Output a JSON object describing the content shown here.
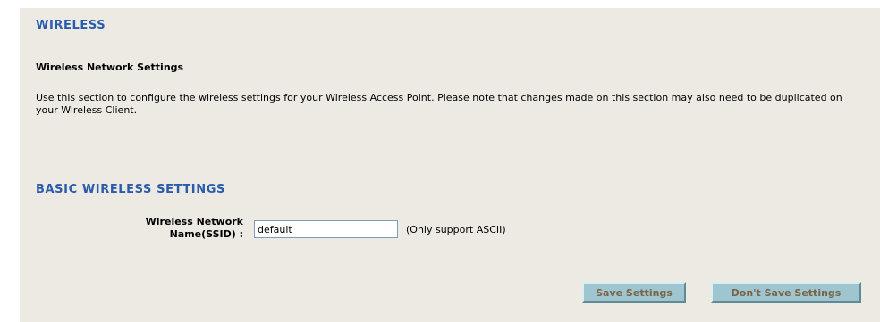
{
  "wireless": {
    "section_title": "WIRELESS",
    "subheading": "Wireless Network Settings",
    "description": "Use this section to configure the wireless settings for your Wireless Access Point. Please note that changes made on this section may also need to be duplicated on your Wireless Client."
  },
  "basic": {
    "section_title": "BASIC WIRELESS SETTINGS",
    "ssid_label_line1": "Wireless Network",
    "ssid_label_line2": "Name(SSID) :",
    "ssid_value": "default",
    "ssid_hint": "(Only support ASCII)"
  },
  "buttons": {
    "save_label": "Save Settings",
    "dont_save_label": "Don't Save Settings"
  },
  "colors": {
    "panel_background": "#eceae3",
    "section_title": "#2b5bac",
    "button_face": "#9fc5d0",
    "button_text": "#7a6447"
  }
}
